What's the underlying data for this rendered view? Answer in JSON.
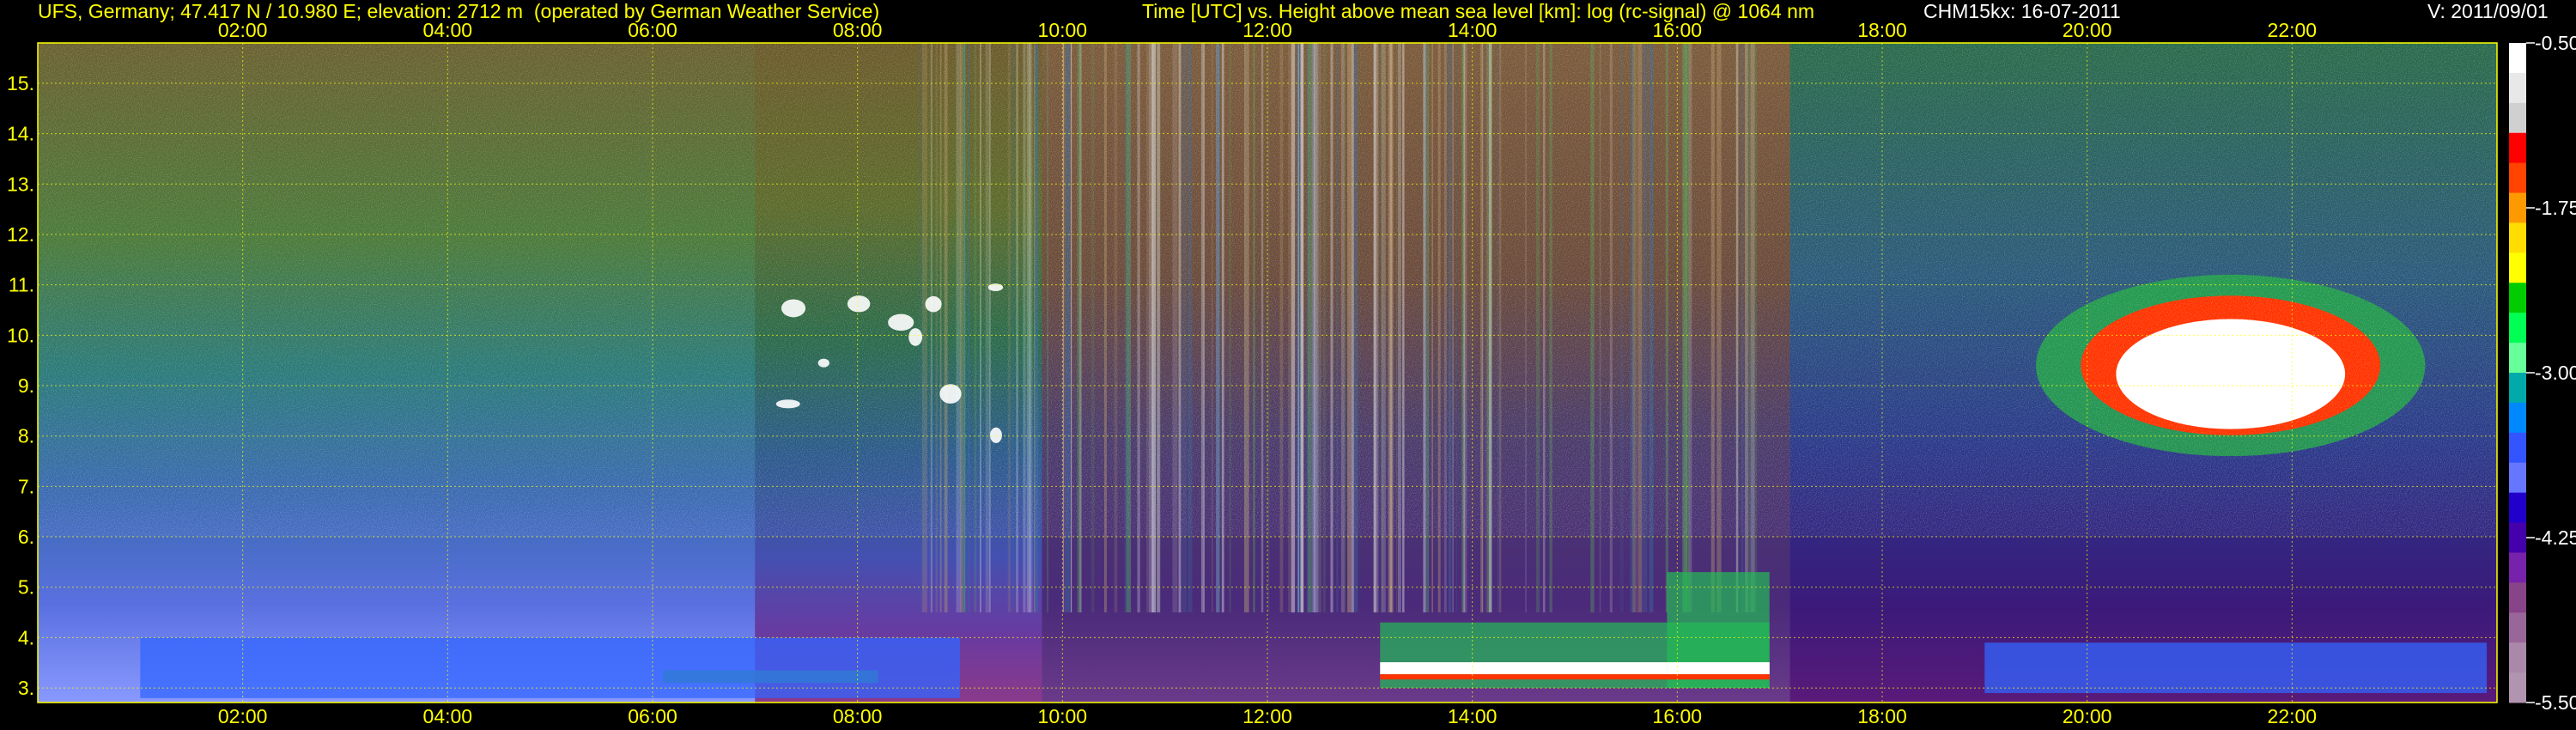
{
  "header": {
    "station": "UFS, Germany; 47.417 N / 10.980 E; elevation: 2712 m  (operated by German Weather Service)",
    "axes_desc": "Time [UTC] vs. Height above mean sea level [km]: log (rc-signal) @ 1064 nm",
    "instrument_date": "CHM15kx: 16-07-2011",
    "version": "V: 2011/09/01"
  },
  "colors": {
    "text": "#ffff00",
    "text_white": "#ffffff",
    "grid": "#ffff00",
    "background": "#000000"
  },
  "chart_data": {
    "type": "heatmap",
    "title": "Time [UTC] vs. Height above mean sea level [km]: log (rc-signal) @ 1064 nm",
    "xlabel": "Time [UTC]",
    "ylabel": "Height above mean sea level [km]",
    "xlim": [
      0,
      24
    ],
    "ylim": [
      2.712,
      15.8
    ],
    "x_ticks": [
      2,
      4,
      6,
      8,
      10,
      12,
      14,
      16,
      18,
      20,
      22
    ],
    "x_tick_labels": [
      "02:00",
      "04:00",
      "06:00",
      "08:00",
      "10:00",
      "12:00",
      "14:00",
      "16:00",
      "18:00",
      "20:00",
      "22:00"
    ],
    "y_ticks": [
      3,
      4,
      5,
      6,
      7,
      8,
      9,
      10,
      11,
      12,
      13,
      14,
      15
    ],
    "y_tick_labels": [
      "3.",
      "4.",
      "5.",
      "6.",
      "7.",
      "8.",
      "9.",
      "10.",
      "11.",
      "12.",
      "13.",
      "14.",
      "15."
    ],
    "grid": true,
    "colorbar": {
      "range": [
        -5.5,
        -0.5
      ],
      "ticks": [
        -0.5,
        -1.75,
        -3.0,
        -4.25,
        -5.5
      ],
      "tick_labels": [
        "-0.50",
        "-1.75",
        "-3.00",
        "-4.25",
        "-5.50"
      ],
      "colors_top_to_bottom": [
        "#ffffff",
        "#e8e8e8",
        "#d0d0d0",
        "#ff0000",
        "#ff4400",
        "#ff9900",
        "#ffdd00",
        "#ffff00",
        "#00cc00",
        "#00ff55",
        "#66ff99",
        "#00aaaa",
        "#0088ff",
        "#3355ff",
        "#6677ff",
        "#2200cc",
        "#4400aa",
        "#7722aa",
        "#884488",
        "#996699",
        "#aa88aa",
        "#b094b0"
      ]
    },
    "features": [
      {
        "name": "boundary layer green",
        "x": [
          6.1,
          8.2
        ],
        "y": [
          3.1,
          3.35
        ],
        "level": -1.9
      },
      {
        "name": "near-surface blue aerosol",
        "x": [
          1.0,
          9.0
        ],
        "y": [
          2.8,
          4.0
        ],
        "level": -3.0
      },
      {
        "name": "low clouds afternoon",
        "x": [
          13.1,
          16.9
        ],
        "y": [
          3.0,
          4.3
        ],
        "level": -0.5
      },
      {
        "name": "convective cloud tower",
        "x": [
          15.9,
          16.9
        ],
        "y": [
          3.0,
          5.3
        ],
        "level": -0.5
      },
      {
        "name": "cirrus cloud evening",
        "x": [
          19.5,
          23.3
        ],
        "y": [
          7.6,
          11.2
        ],
        "level": -0.5
      },
      {
        "name": "thin cirrus patches morning",
        "x": [
          7.1,
          9.4
        ],
        "y": [
          8.0,
          11.0
        ],
        "level": -0.8
      },
      {
        "name": "evening boundary layer blue",
        "x": [
          19.0,
          23.9
        ],
        "y": [
          2.9,
          3.9
        ],
        "level": -3.0
      }
    ]
  }
}
